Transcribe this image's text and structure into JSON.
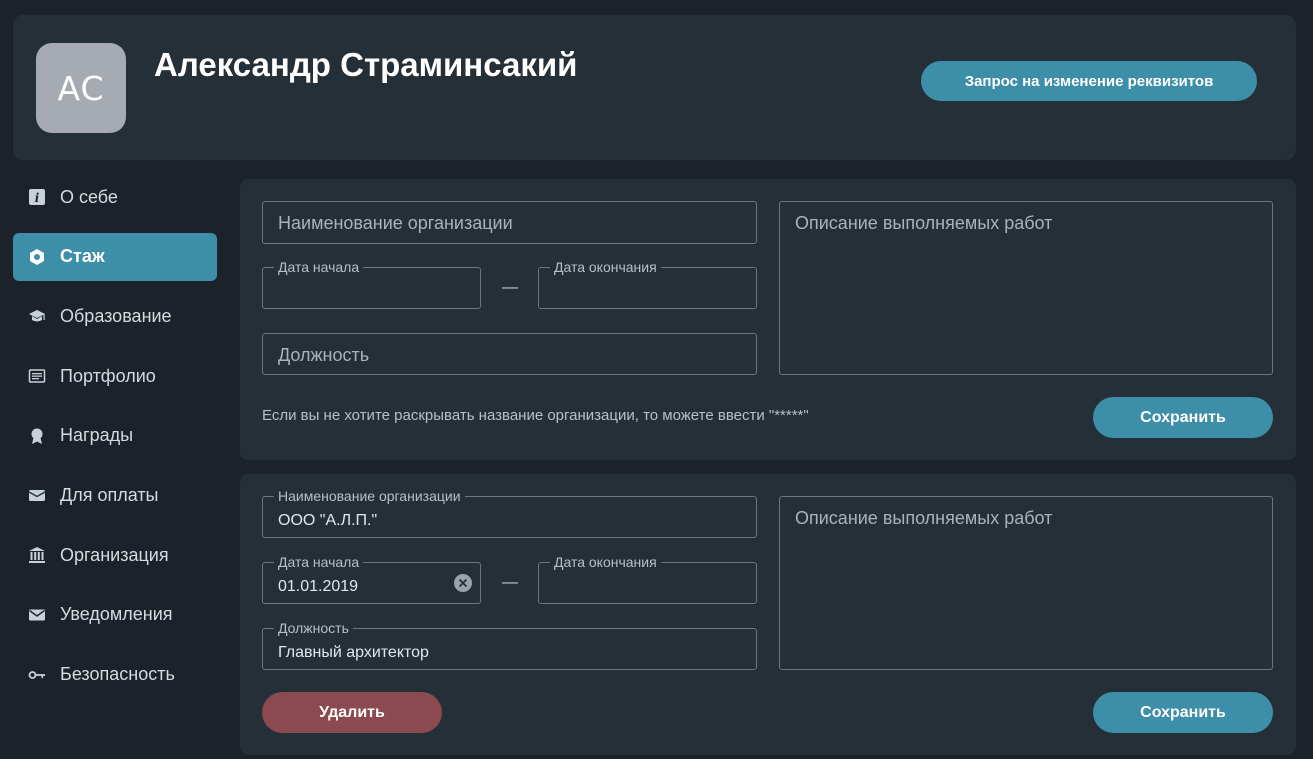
{
  "profile": {
    "initials": "AC",
    "name": "Александр Страминсакий",
    "request_button": "Запрос на изменение реквизитов"
  },
  "sidebar": {
    "items": [
      {
        "label": "О себе",
        "icon": "info-icon"
      },
      {
        "label": "Стаж",
        "icon": "hexagon-icon",
        "active": true
      },
      {
        "label": "Образование",
        "icon": "graduation-cap-icon"
      },
      {
        "label": "Портфолио",
        "icon": "document-icon"
      },
      {
        "label": "Награды",
        "icon": "award-icon"
      },
      {
        "label": "Для оплаты",
        "icon": "wallet-icon"
      },
      {
        "label": "Организация",
        "icon": "bank-icon"
      },
      {
        "label": "Уведомления",
        "icon": "envelope-icon"
      },
      {
        "label": "Безопасность",
        "icon": "key-icon"
      }
    ]
  },
  "form_new": {
    "org_placeholder": "Наименование организации",
    "start_label": "Дата начала",
    "end_label": "Дата окончания",
    "dash": "—",
    "position_placeholder": "Должность",
    "description_placeholder": "Описание выполняемых работ",
    "hint": "Если вы не хотите раскрывать название организации, то можете ввести \"*****\"",
    "save_label": "Сохранить"
  },
  "form_existing": {
    "org_label": "Наименование организации",
    "org_value": "ООО \"А.Л.П.\"",
    "start_label": "Дата начала",
    "start_value": "01.01.2019",
    "end_label": "Дата окончания",
    "dash": "—",
    "position_label": "Должность",
    "position_value": "Главный архитектор",
    "description_placeholder": "Описание выполняемых работ",
    "delete_label": "Удалить",
    "save_label": "Сохранить"
  },
  "colors": {
    "background": "#1b2229",
    "card": "#252f38",
    "accent": "#3d8ea8",
    "danger": "#8b4a50"
  }
}
